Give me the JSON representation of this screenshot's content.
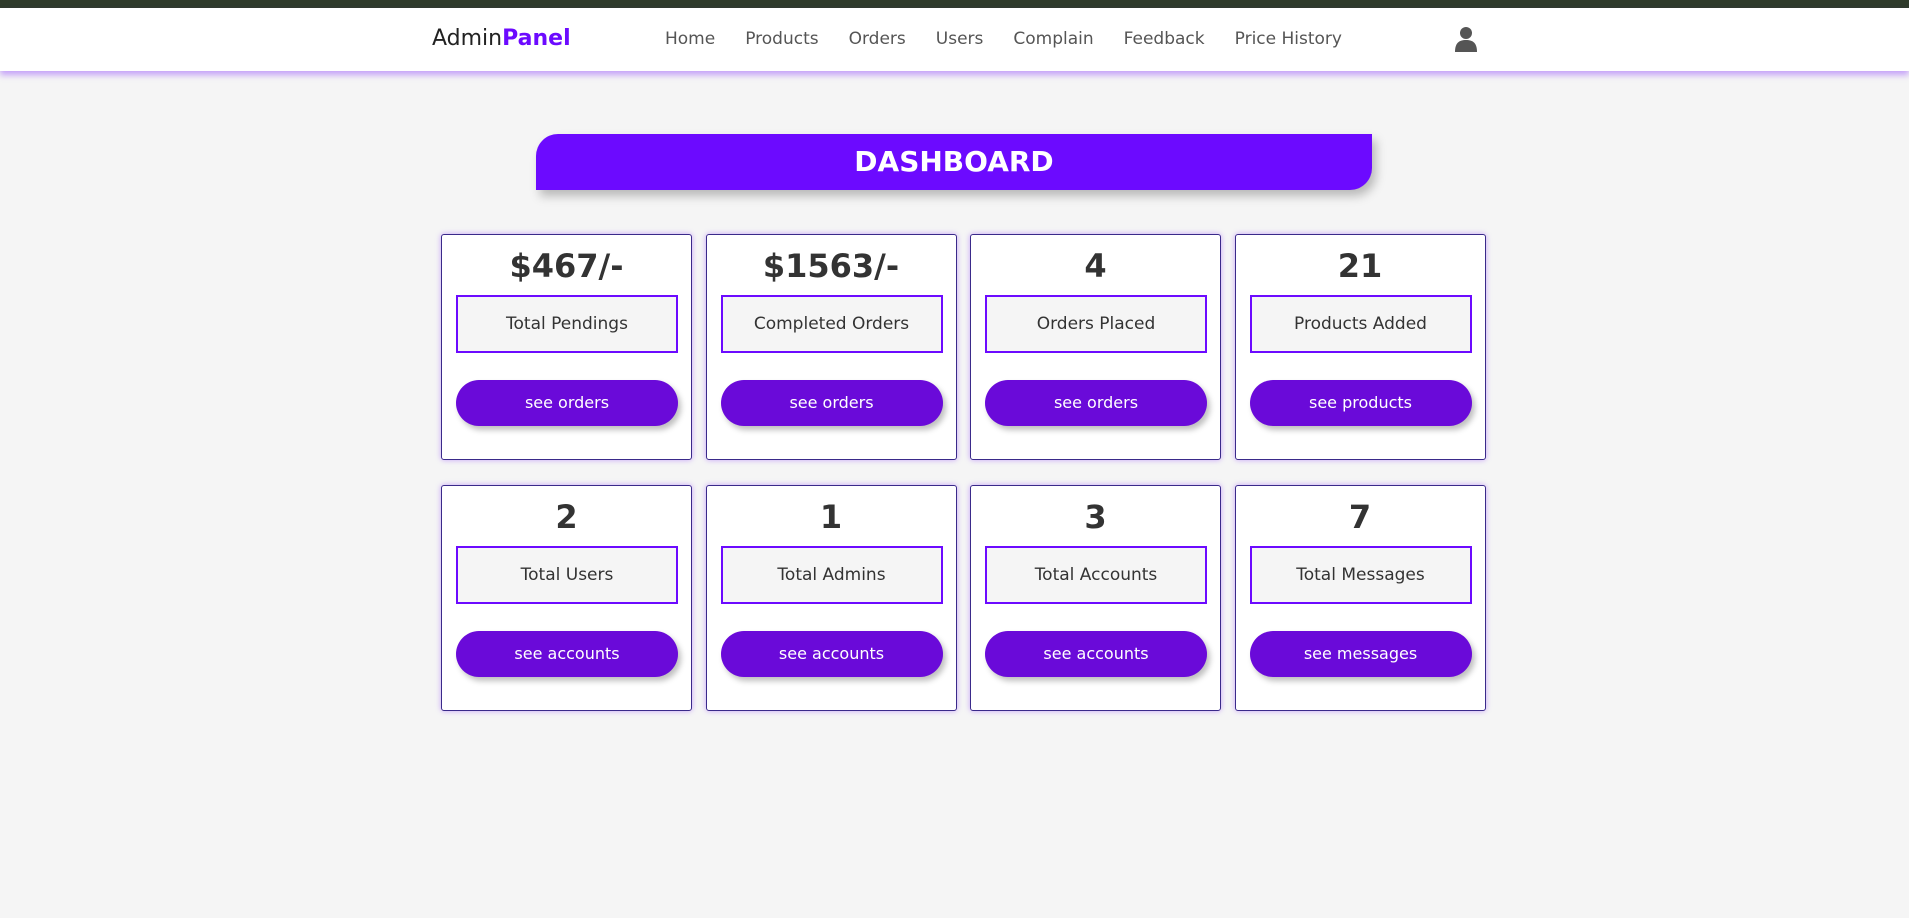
{
  "colors": {
    "accent": "#6c0aff",
    "button": "#6a0ad9",
    "topbar": "#2f3b2b",
    "background": "#f5f5f5"
  },
  "header": {
    "logo_prefix": "Admin",
    "logo_accent": "Panel",
    "nav": [
      "Home",
      "Products",
      "Orders",
      "Users",
      "Complain",
      "Feedback",
      "Price History"
    ],
    "user_icon": "user-icon"
  },
  "banner": {
    "title": "DASHBOARD"
  },
  "cards": [
    {
      "value": "$467/-",
      "label": "Total Pendings",
      "button": "see orders"
    },
    {
      "value": "$1563/-",
      "label": "Completed Orders",
      "button": "see orders"
    },
    {
      "value": "4",
      "label": "Orders Placed",
      "button": "see orders"
    },
    {
      "value": "21",
      "label": "Products Added",
      "button": "see products"
    },
    {
      "value": "2",
      "label": "Total Users",
      "button": "see accounts"
    },
    {
      "value": "1",
      "label": "Total Admins",
      "button": "see accounts"
    },
    {
      "value": "3",
      "label": "Total Accounts",
      "button": "see accounts"
    },
    {
      "value": "7",
      "label": "Total Messages",
      "button": "see messages"
    }
  ]
}
